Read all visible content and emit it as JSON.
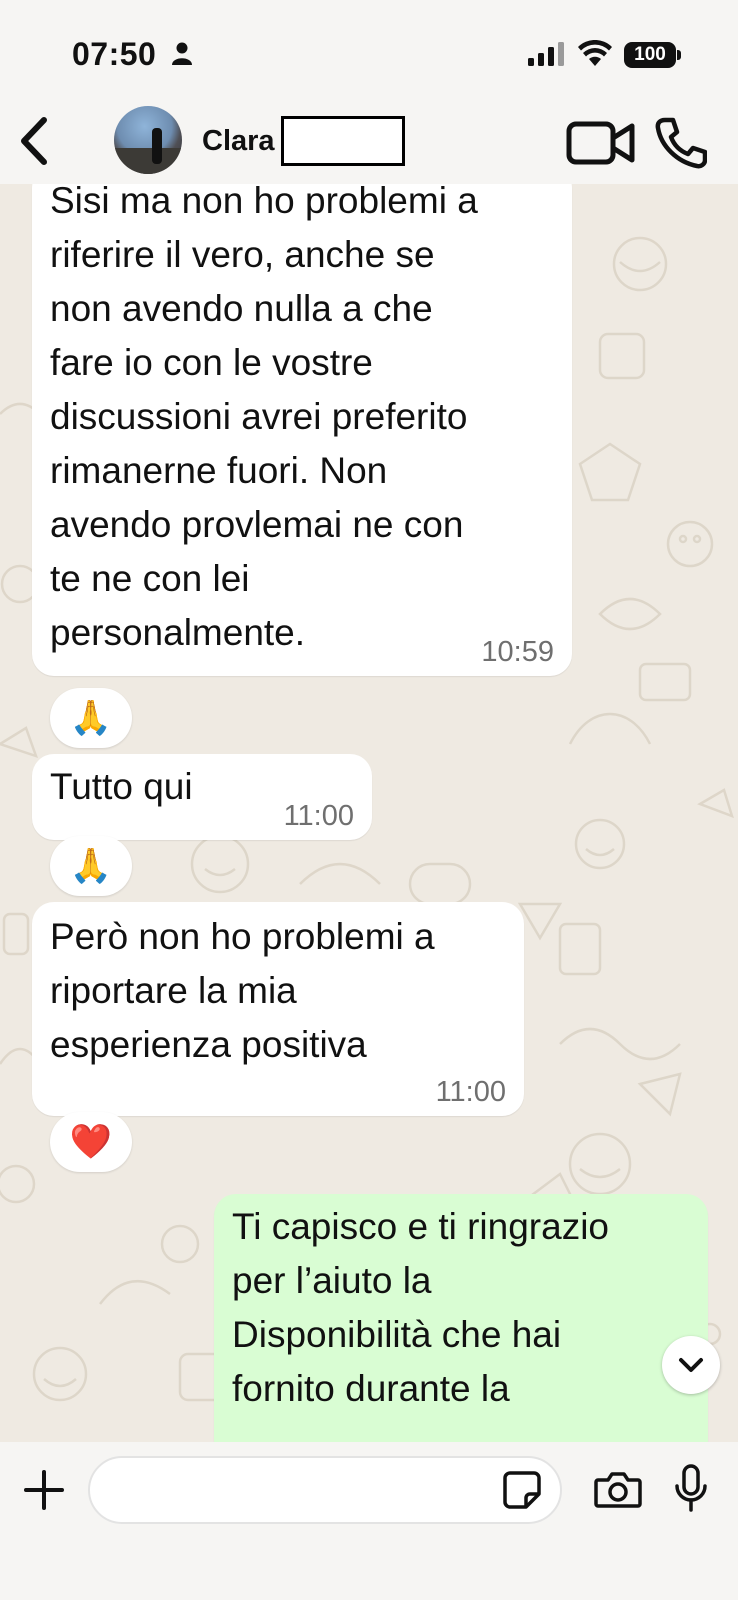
{
  "status_bar": {
    "time": "07:50",
    "battery": "100"
  },
  "header": {
    "contact_name": "Clara",
    "icons": [
      "chevron-left-icon",
      "video-camera-icon",
      "phone-icon"
    ]
  },
  "messages": [
    {
      "direction": "incoming",
      "text": "Sisi ma non ho problemi a\nriferire il vero, anche se\nnon avendo nulla a che\nfare io con le vostre\ndiscussioni avrei preferito\nrimanerne fuori. Non\navendo provlemai ne con\nte ne con lei\npersonalmente.",
      "time": "10:59",
      "reaction": "🙏"
    },
    {
      "direction": "incoming",
      "text": "Tutto qui",
      "time": "11:00",
      "reaction": "🙏"
    },
    {
      "direction": "incoming",
      "text": "Però non ho problemi a\nriportare la mia\nesperienza positiva",
      "time": "11:00",
      "reaction": "❤️"
    },
    {
      "direction": "outgoing",
      "text": "Ti capisco e ti ringrazio\nper l’aiuto la\nDisponibilità che hai\nfornito durante la",
      "time": ""
    }
  ],
  "input": {
    "placeholder": "",
    "icons": [
      "plus-icon",
      "sticker-icon",
      "camera-icon",
      "microphone-icon"
    ]
  },
  "colors": {
    "chat_background": "#efeae2",
    "incoming_bubble": "#ffffff",
    "outgoing_bubble": "#d9fdd3",
    "bars": "#f6f5f3"
  }
}
